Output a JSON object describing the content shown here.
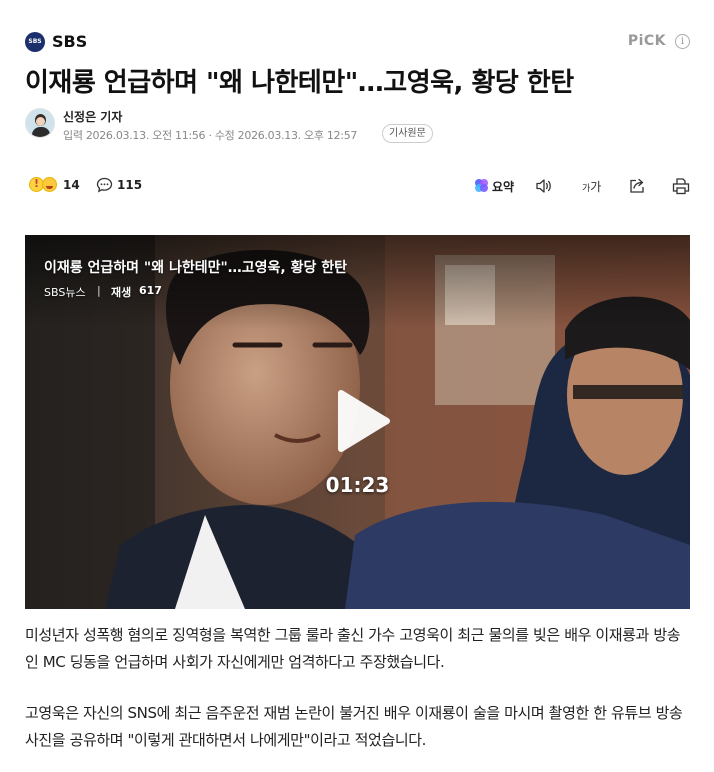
{
  "press": {
    "logo_text": "SBS",
    "name": "SBS",
    "pick_label": "PiCK",
    "info_symbol": "i"
  },
  "article": {
    "title": "이재룡 언급하며 \"왜 나한테만\"…고영욱, 황당 한탄",
    "reporter": "신정은 기자",
    "dates": "입력 2026.03.13. 오전 11:56 · 수정 2026.03.13. 오후 12:57",
    "original_button": "기사원문"
  },
  "actions": {
    "reaction_count": "14",
    "comment_count": "115",
    "summary_label": "요약",
    "font_label_small": "가",
    "font_label_large": "가"
  },
  "video": {
    "title": "이재룡 언급하며 \"왜 나한테만\"…고영욱, 황당 한탄",
    "source": "SBS뉴스",
    "separator": "|",
    "views_label": "재생",
    "views_count": "617",
    "duration": "01:23"
  },
  "body": {
    "paragraph1": "미성년자 성폭행 혐의로 징역형을 복역한 그룹 룰라 출신 가수 고영욱이 최근 물의를 빚은 배우 이재룡과 방송인 MC 딩동을 언급하며 사회가 자신에게만 엄격하다고 주장했습니다.",
    "paragraph2": "고영욱은 자신의 SNS에 최근 음주운전 재범 논란이 불거진 배우 이재룡이 술을 마시며 촬영한 한 유튜브 방송 사진을 공유하며 \"이렇게 관대하면서 나에게만\"이라고 적었습니다."
  },
  "colors": {
    "accent": "#1a2f6b",
    "text": "#111111",
    "muted": "#888888"
  }
}
